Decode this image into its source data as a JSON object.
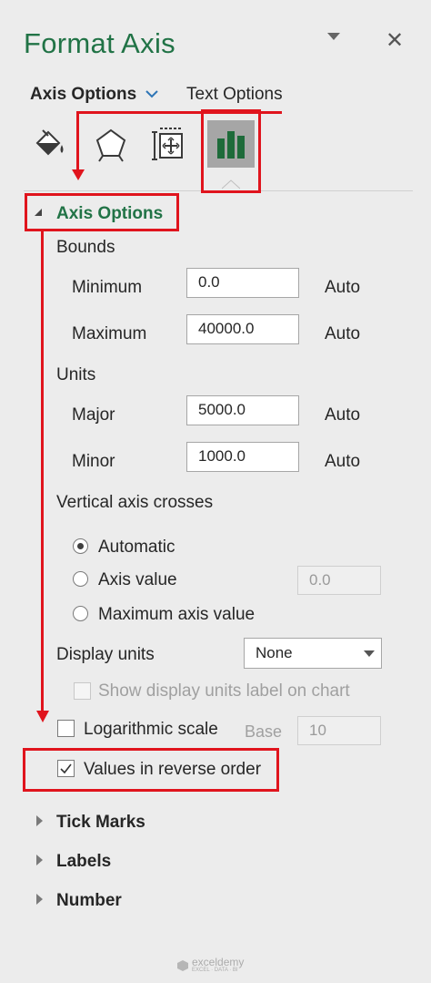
{
  "pane": {
    "title": "Format Axis",
    "tabs": {
      "axis_options": "Axis Options",
      "text_options": "Text Options"
    }
  },
  "icons": [
    "fill-line-icon",
    "effects-icon",
    "size-properties-icon",
    "axis-options-icon"
  ],
  "axis_section": {
    "title": "Axis Options",
    "bounds_label": "Bounds",
    "minimum": {
      "label": "Minimum",
      "value": "0.0",
      "auto": "Auto"
    },
    "maximum": {
      "label": "Maximum",
      "value": "40000.0",
      "auto": "Auto"
    },
    "units_label": "Units",
    "major": {
      "label": "Major",
      "value": "5000.0",
      "auto": "Auto"
    },
    "minor": {
      "label": "Minor",
      "value": "1000.0",
      "auto": "Auto"
    },
    "crosses_label": "Vertical axis crosses",
    "crosses_options": {
      "automatic": "Automatic",
      "axis_value": "Axis value",
      "axis_value_input": "0.0",
      "maximum_axis_value": "Maximum axis value"
    },
    "display_units": {
      "label": "Display units",
      "value": "None"
    },
    "show_units_label": "Show display units label on chart",
    "log_scale": {
      "label": "Logarithmic scale",
      "base_label": "Base",
      "base_value": "10"
    },
    "reverse_order": "Values in reverse order"
  },
  "collapsed_sections": [
    "Tick Marks",
    "Labels",
    "Number"
  ],
  "watermark": {
    "name": "exceldemy",
    "tagline": "EXCEL · DATA · BI"
  },
  "colors": {
    "accent_green": "#217346",
    "annotation_red": "#e0141d",
    "selected_icon_bg": "#a6a6a6"
  }
}
